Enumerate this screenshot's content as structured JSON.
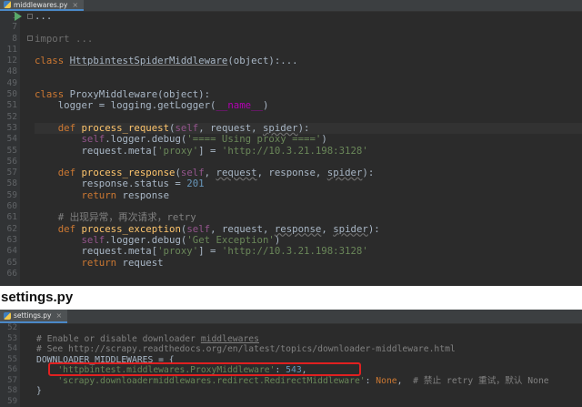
{
  "top_editor": {
    "tab_label": "middlewares.py",
    "line_numbers": [
      "1",
      "7",
      "8",
      "11",
      "12",
      "48",
      "49",
      "50",
      "51",
      "52",
      "53",
      "54",
      "55",
      "56",
      "57",
      "58",
      "59",
      "60",
      "61",
      "62",
      "63",
      "64",
      "65",
      "66"
    ],
    "lines": [
      {
        "parts": [
          {
            "t": "..."
          }
        ]
      },
      {
        "parts": [
          {
            "t": ""
          }
        ]
      },
      {
        "parts": [
          {
            "t": "import ...",
            "c": "fold"
          }
        ]
      },
      {
        "parts": [
          {
            "t": ""
          }
        ]
      },
      {
        "parts": [
          {
            "t": "class ",
            "c": "kw"
          },
          {
            "t": "HttpbintestSpiderMiddleware",
            "c": "ul"
          },
          {
            "t": "(object):..."
          }
        ]
      },
      {
        "parts": [
          {
            "t": ""
          }
        ]
      },
      {
        "parts": [
          {
            "t": ""
          }
        ]
      },
      {
        "parts": [
          {
            "t": "class ",
            "c": "kw"
          },
          {
            "t": "ProxyMiddleware(object):"
          }
        ]
      },
      {
        "parts": [
          {
            "t": "    logger = logging.getLogger("
          },
          {
            "t": "__name__",
            "c": "mg"
          },
          {
            "t": ")"
          }
        ]
      },
      {
        "parts": [
          {
            "t": ""
          }
        ]
      },
      {
        "parts": [
          {
            "t": "    "
          },
          {
            "t": "def ",
            "c": "kw"
          },
          {
            "t": "process_request",
            "c": "fn"
          },
          {
            "t": "("
          },
          {
            "t": "self",
            "c": "self"
          },
          {
            "t": ", request, "
          },
          {
            "t": "spider",
            "c": "wavy"
          },
          {
            "t": "):"
          }
        ],
        "hl": true
      },
      {
        "parts": [
          {
            "t": "        "
          },
          {
            "t": "self",
            "c": "self"
          },
          {
            "t": ".logger.debug("
          },
          {
            "t": "'==== Using proxy ===='",
            "c": "st"
          },
          {
            "t": ")"
          }
        ]
      },
      {
        "parts": [
          {
            "t": "        request.meta["
          },
          {
            "t": "'proxy'",
            "c": "st"
          },
          {
            "t": "] = "
          },
          {
            "t": "'http://10.3.21.198:3128'",
            "c": "st"
          }
        ]
      },
      {
        "parts": [
          {
            "t": ""
          }
        ]
      },
      {
        "parts": [
          {
            "t": "    "
          },
          {
            "t": "def ",
            "c": "kw"
          },
          {
            "t": "process_response",
            "c": "fn"
          },
          {
            "t": "("
          },
          {
            "t": "self",
            "c": "self"
          },
          {
            "t": ", "
          },
          {
            "t": "request",
            "c": "wavy"
          },
          {
            "t": ", response, "
          },
          {
            "t": "spider",
            "c": "wavy"
          },
          {
            "t": "):"
          }
        ]
      },
      {
        "parts": [
          {
            "t": "        response.status = "
          },
          {
            "t": "201",
            "c": "nm"
          }
        ]
      },
      {
        "parts": [
          {
            "t": "        "
          },
          {
            "t": "return ",
            "c": "kw"
          },
          {
            "t": "response"
          }
        ]
      },
      {
        "parts": [
          {
            "t": ""
          }
        ]
      },
      {
        "parts": [
          {
            "t": "    "
          },
          {
            "t": "# 出现异常，再次请求，retry",
            "c": "cm"
          }
        ]
      },
      {
        "parts": [
          {
            "t": "    "
          },
          {
            "t": "def ",
            "c": "kw"
          },
          {
            "t": "process_exception",
            "c": "fn"
          },
          {
            "t": "("
          },
          {
            "t": "self",
            "c": "self"
          },
          {
            "t": ", request, "
          },
          {
            "t": "response",
            "c": "wavy"
          },
          {
            "t": ", "
          },
          {
            "t": "spider",
            "c": "wavy"
          },
          {
            "t": "):"
          }
        ]
      },
      {
        "parts": [
          {
            "t": "        "
          },
          {
            "t": "self",
            "c": "self"
          },
          {
            "t": ".logger.debug("
          },
          {
            "t": "'Get Exception'",
            "c": "st"
          },
          {
            "t": ")"
          }
        ]
      },
      {
        "parts": [
          {
            "t": "        request.meta["
          },
          {
            "t": "'proxy'",
            "c": "st"
          },
          {
            "t": "] = "
          },
          {
            "t": "'http://10.3.21.198:3128'",
            "c": "st"
          }
        ]
      },
      {
        "parts": [
          {
            "t": "        "
          },
          {
            "t": "return ",
            "c": "kw"
          },
          {
            "t": "request"
          }
        ]
      },
      {
        "parts": [
          {
            "t": ""
          }
        ]
      }
    ]
  },
  "heading": "settings.py",
  "bottom_editor": {
    "tab_label": "settings.py",
    "line_numbers": [
      "52",
      "53",
      "54",
      "55",
      "56",
      "57",
      "58",
      "59"
    ],
    "lines": [
      {
        "parts": [
          {
            "t": ""
          }
        ]
      },
      {
        "parts": [
          {
            "t": "# Enable or disable downloader ",
            "c": "cm"
          },
          {
            "t": "middlewares",
            "c": "cm ul"
          }
        ]
      },
      {
        "parts": [
          {
            "t": "# See http://scrapy.readthedocs.org/en/latest/topics/downloader-middleware.html",
            "c": "cm"
          }
        ]
      },
      {
        "parts": [
          {
            "t": "DOWNLOADER_MIDDLEWARES = {"
          }
        ]
      },
      {
        "parts": [
          {
            "t": "    "
          },
          {
            "t": "'httpbintest.middlewares.ProxyMiddleware'",
            "c": "st"
          },
          {
            "t": ": "
          },
          {
            "t": "543",
            "c": "nm"
          },
          {
            "t": ","
          }
        ]
      },
      {
        "parts": [
          {
            "t": "    "
          },
          {
            "t": "'scrapy.downloadermiddlewares.redirect.RedirectMiddleware'",
            "c": "st"
          },
          {
            "t": ": "
          },
          {
            "t": "None",
            "c": "kw"
          },
          {
            "t": ",  "
          },
          {
            "t": "# 禁止 retry 重试，默认 None",
            "c": "cm"
          }
        ]
      },
      {
        "parts": [
          {
            "t": "}"
          }
        ]
      },
      {
        "parts": [
          {
            "t": ""
          }
        ]
      }
    ]
  }
}
